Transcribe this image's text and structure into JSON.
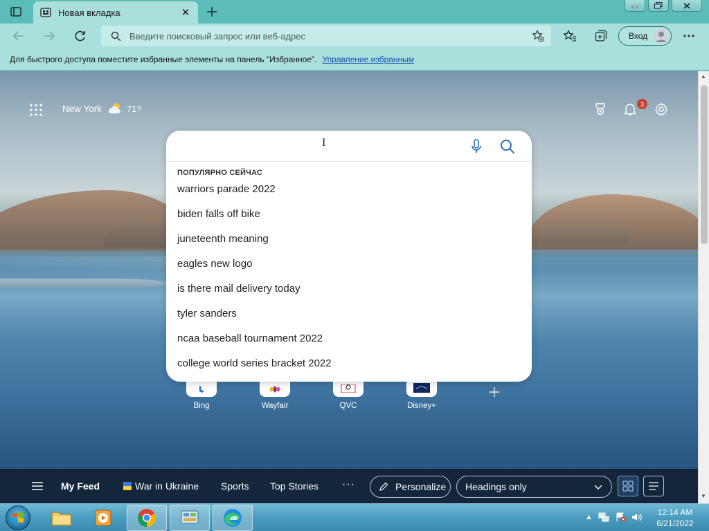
{
  "browser": {
    "tab": {
      "title": "Новая вкладка"
    },
    "address_bar": {
      "placeholder": "Введите поисковый запрос или веб-адрес",
      "value": ""
    },
    "signin_label": "Вход",
    "favorites_bar": {
      "text": "Для быстрого доступа поместите избранные элементы на панель \"Избранное\".",
      "link": "Управление избранным"
    }
  },
  "newtab": {
    "weather": {
      "location": "New York",
      "temp": "71",
      "unit": "°F"
    },
    "notifications_count": "3",
    "search": {
      "value": "",
      "trending_title": "ПОПУЛЯРНО СЕЙЧАС",
      "suggestions": [
        "warriors parade 2022",
        "biden falls off bike",
        "juneteenth meaning",
        "eagles new logo",
        "is there mail delivery today",
        "tyler sanders",
        "ncaa baseball tournament 2022",
        "college world series bracket 2022"
      ]
    },
    "quick_links": [
      {
        "label": "Bing"
      },
      {
        "label": "Wayfair"
      },
      {
        "label": "QVC"
      },
      {
        "label": "Disney+"
      }
    ],
    "feed": {
      "tabs": [
        "My Feed",
        "War in Ukraine",
        "Sports",
        "Top Stories"
      ],
      "more": "···",
      "personalize_label": "Personalize",
      "layout_value": "Headings only"
    }
  },
  "taskbar": {
    "time": "12:14 AM",
    "date": "6/21/2022"
  },
  "colors": {
    "tab_bar": "#5cbcb8",
    "toolbar": "#a9e0dc",
    "accent_link": "#1150b5",
    "feedbar": "#122032",
    "badge": "#c8402d"
  }
}
